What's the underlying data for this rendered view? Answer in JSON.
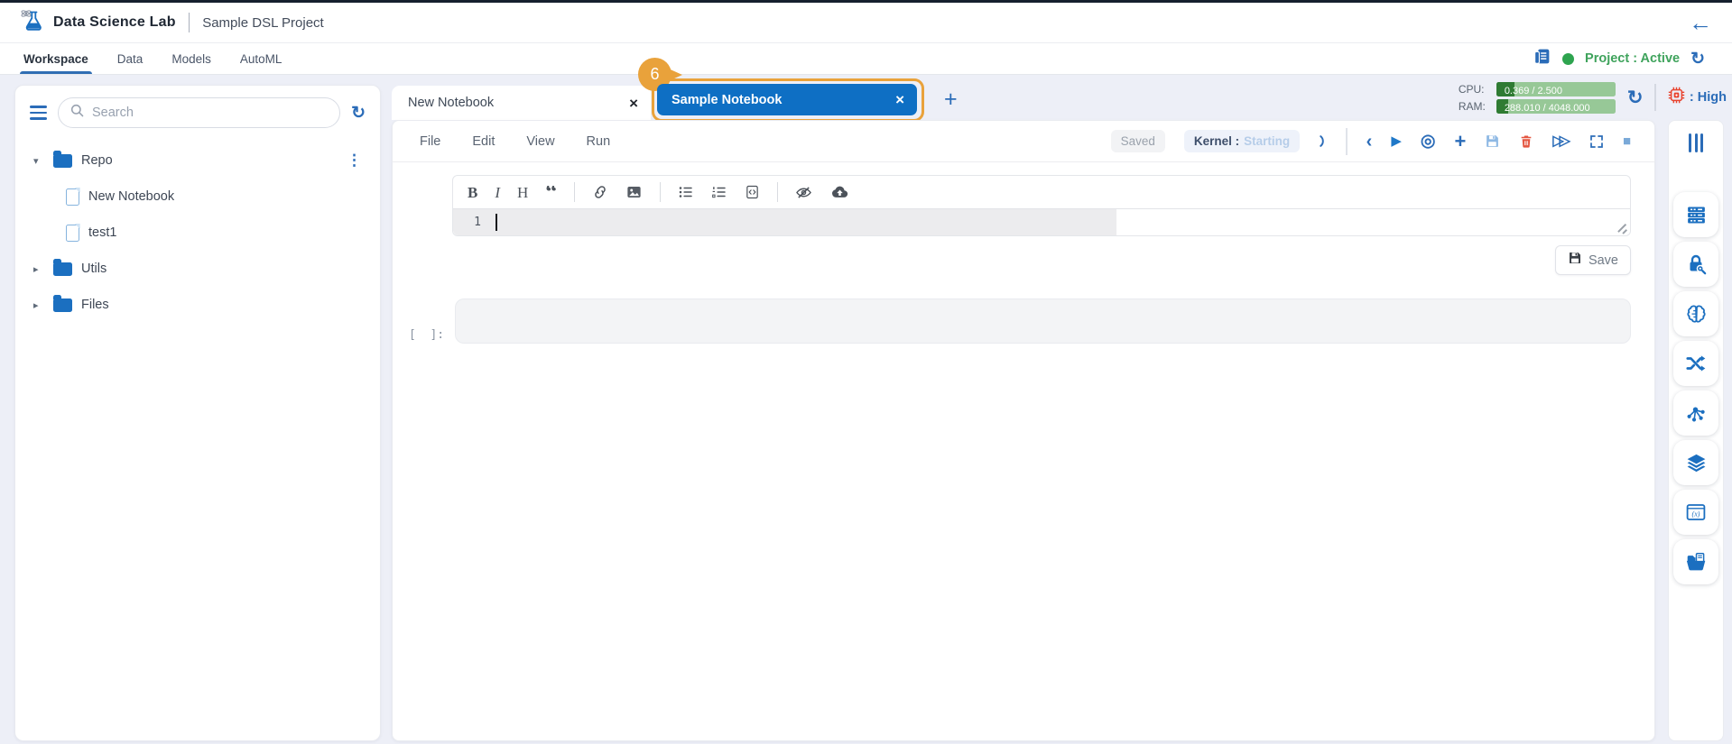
{
  "app": {
    "name": "Data Science Lab",
    "project": "Sample DSL Project"
  },
  "nav": {
    "tabs": [
      "Workspace",
      "Data",
      "Models",
      "AutoML"
    ],
    "project_status": "Project : Active"
  },
  "resources": {
    "cpu_label": "CPU:",
    "cpu_value": "0.369 / 2.500",
    "ram_label": "RAM:",
    "ram_value": "288.010 / 4048.000",
    "priority": ": High"
  },
  "sidebar": {
    "search_placeholder": "Search",
    "tree": [
      {
        "label": "Repo"
      },
      {
        "label": "New Notebook"
      },
      {
        "label": "test1"
      },
      {
        "label": "Utils"
      },
      {
        "label": "Files"
      }
    ]
  },
  "notebook_tabs": {
    "tab1": "New Notebook",
    "tab2": "Sample Notebook",
    "annotation_badge": "6"
  },
  "menubar": {
    "items": [
      "File",
      "Edit",
      "View",
      "Run"
    ],
    "saved": "Saved",
    "kernel_label": "Kernel :",
    "kernel_state": "Starting"
  },
  "editor": {
    "line_number": "1",
    "save_label": "Save",
    "cell_prompt": "[  ]:"
  },
  "icons": {
    "back": "←",
    "refresh": "↻",
    "close": "×",
    "add": "+",
    "kebab": "⋮",
    "caret_down": "▾",
    "caret_right": "▸",
    "chevron_left": "‹",
    "play": "▶",
    "target": "◎",
    "stop": "■",
    "fast_forward": "▷▷",
    "bold": "B",
    "italic": "I",
    "heading": "H",
    "quote": "“",
    "code_window": "(x)"
  },
  "colors": {
    "primary_blue": "#1b6fc0",
    "annotation_orange": "#e9a23b",
    "status_green": "#3fa35c",
    "bar_green_light": "#97c897",
    "bar_green_dark": "#2f7b33",
    "danger_red": "#e4553f",
    "chip_red": "#e8432e",
    "page_bg": "#edeff7",
    "active_tab_blue": "#0e6fc4"
  }
}
